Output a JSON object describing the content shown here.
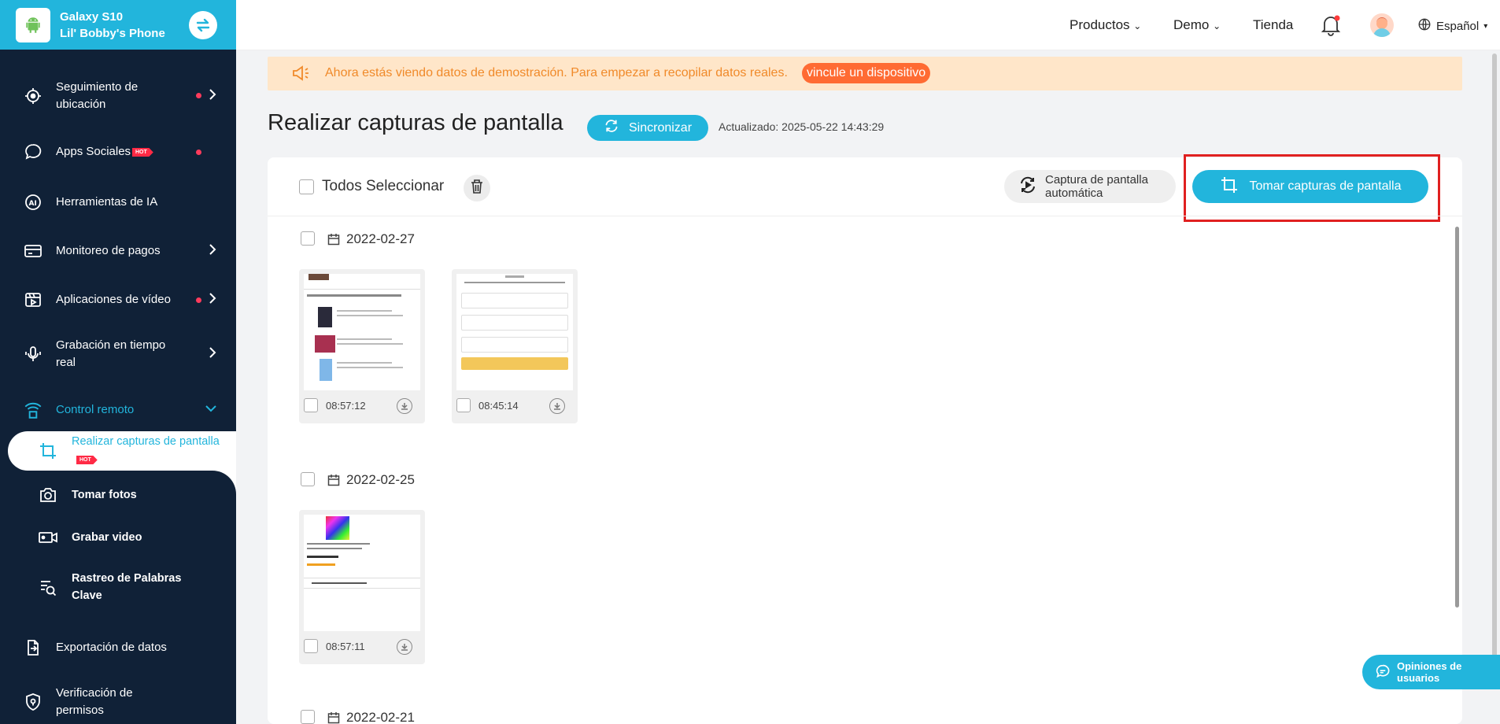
{
  "device": {
    "model": "Galaxy S10",
    "owner": "Lil' Bobby's Phone"
  },
  "sidebar": {
    "items": [
      {
        "label_line1": "Seguimiento de",
        "label_line2": "ubicación"
      },
      {
        "label": "Apps Sociales",
        "badge": "HOT"
      },
      {
        "label": "Herramientas de IA"
      },
      {
        "label": "Monitoreo de pagos"
      },
      {
        "label": "Aplicaciones de vídeo"
      },
      {
        "label_line1": "Grabación en tiempo",
        "label_line2": "real"
      },
      {
        "label": "Control remoto"
      },
      {
        "label_line1": "Exportación de datos"
      },
      {
        "label_line1": "Verificación de",
        "label_line2": "permisos"
      }
    ],
    "sub_items": [
      {
        "label": "Realizar capturas de pantalla",
        "badge": "HOT"
      },
      {
        "label": "Tomar fotos"
      },
      {
        "label": "Grabar video"
      },
      {
        "label_line1": "Rastreo de Palabras",
        "label_line2": "Clave"
      }
    ]
  },
  "topbar": {
    "products": "Productos",
    "demo": "Demo",
    "store": "Tienda",
    "language": "Español"
  },
  "banner": {
    "text": "Ahora estás viendo datos de demostración. Para empezar a recopilar datos reales.",
    "link": "vincule un dispositivo"
  },
  "page": {
    "title": "Realizar capturas de pantalla",
    "sync_label": "Sincronizar",
    "updated": "Actualizado: 2025-05-22 14:43:29",
    "select_all": "Todos Seleccionar",
    "auto_line1": "Captura de pantalla",
    "auto_line2": "automática",
    "take_button": "Tomar capturas de pantalla"
  },
  "groups": [
    {
      "date": "2022-02-27",
      "shots": [
        {
          "time": "08:57:12"
        },
        {
          "time": "08:45:14"
        }
      ]
    },
    {
      "date": "2022-02-25",
      "shots": [
        {
          "time": "08:57:11"
        }
      ]
    },
    {
      "date": "2022-02-21",
      "shots": []
    }
  ],
  "feedback": "Opiniones de usuarios",
  "colors": {
    "accent": "#22b5dc",
    "sidebar": "#102137",
    "highlight": "#e02020"
  }
}
